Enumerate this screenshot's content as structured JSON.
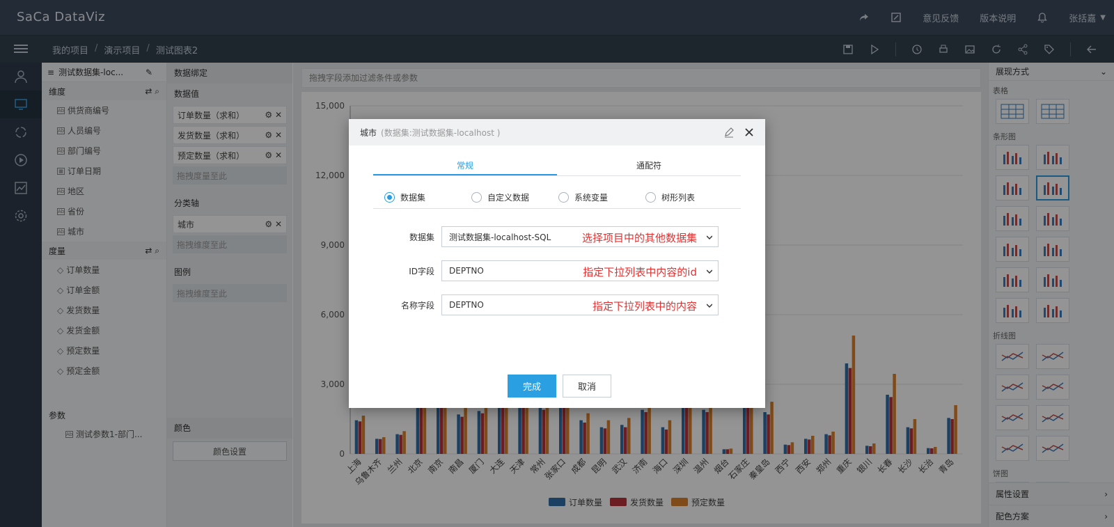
{
  "app": {
    "logo": "SaCa DataViz"
  },
  "header": {
    "feedback": "意见反馈",
    "version": "版本说明",
    "user": "张括嘉"
  },
  "breadcrumb": [
    "我的项目",
    "演示项目",
    "测试图表2"
  ],
  "dataset_panel": {
    "title": "测试数据集-loc...",
    "dimension_label": "维度",
    "dimensions": [
      "供货商编号",
      "人员编号",
      "部门编号",
      "订单日期",
      "地区",
      "省份",
      "城市"
    ],
    "measure_label": "度量",
    "measures": [
      "订单数量",
      "订单金额",
      "发货数量",
      "发货金额",
      "预定数量",
      "预定金额"
    ],
    "param_label": "参数",
    "params": [
      "测试参数1-部门..."
    ]
  },
  "binding_panel": {
    "title": "数据绑定",
    "values_label": "数据值",
    "values": [
      "订单数量（求和）",
      "发货数量（求和）",
      "预定数量（求和）"
    ],
    "values_drop": "拖拽度量至此",
    "axis_label": "分类轴",
    "axis": [
      "城市"
    ],
    "axis_drop": "拖拽维度至此",
    "legend_label": "图例",
    "legend_drop": "拖拽维度至此",
    "color_label": "颜色",
    "color_btn": "颜色设置"
  },
  "filter_hint": "拖拽字段添加过滤条件或参数",
  "chart_data": {
    "type": "bar",
    "categories": [
      "上海",
      "乌鲁木齐",
      "兰州",
      "北京",
      "南京",
      "南昌",
      "厦门",
      "大连",
      "天津",
      "常州",
      "张家口",
      "成都",
      "昆明",
      "武汉",
      "济南",
      "海口",
      "深圳",
      "温州",
      "烟台",
      "石家庄",
      "秦皇岛",
      "西宁",
      "西安",
      "郑州",
      "重庆",
      "银川",
      "长春",
      "长沙",
      "长治",
      "青岛"
    ],
    "yticks": [
      "0",
      "3,000",
      "6,000",
      "9,000",
      "12,000",
      "15,000"
    ],
    "ylim": [
      0,
      15000
    ],
    "series": [
      {
        "name": "订单数量",
        "color": "#2f6fa8",
        "values": [
          1450,
          650,
          850,
          3200,
          3500,
          1700,
          1850,
          3300,
          3400,
          2000,
          3100,
          1450,
          1150,
          1250,
          1900,
          1150,
          3500,
          1900,
          200,
          3700,
          1800,
          400,
          650,
          850,
          3900,
          350,
          2550,
          1150,
          250,
          1550
        ]
      },
      {
        "name": "发货数量",
        "color": "#b8323a",
        "values": [
          1400,
          640,
          820,
          3100,
          3400,
          1600,
          1750,
          3200,
          3300,
          1900,
          3000,
          1350,
          1100,
          1150,
          1800,
          1050,
          3400,
          1800,
          200,
          3600,
          1700,
          380,
          620,
          800,
          3700,
          330,
          2450,
          1100,
          240,
          1500
        ]
      },
      {
        "name": "预定数量",
        "color": "#d9822b",
        "values": [
          1650,
          720,
          980,
          3600,
          3900,
          2050,
          2300,
          3700,
          3800,
          2350,
          3500,
          1750,
          1450,
          1550,
          2250,
          1450,
          3900,
          2300,
          230,
          4100,
          2250,
          500,
          780,
          960,
          5100,
          450,
          3450,
          1500,
          300,
          2100
        ]
      }
    ],
    "legend": [
      "订单数量",
      "发货数量",
      "预定数量"
    ]
  },
  "right_panel": {
    "title": "展现方式",
    "sections": [
      "表格",
      "条形图",
      "折线图",
      "饼图"
    ],
    "property": "属性设置",
    "palette": "配色方案"
  },
  "modal": {
    "title": "城市",
    "subtitle": "(数据集:测试数据集-localhost )",
    "tabs": [
      "常规",
      "通配符"
    ],
    "radios": [
      "数据集",
      "自定义数据",
      "系统变量",
      "树形列表"
    ],
    "fields": [
      {
        "label": "数据集",
        "value": "测试数据集-localhost-SQL",
        "note": "选择项目中的其他数据集"
      },
      {
        "label": "ID字段",
        "value": "DEPTNO",
        "note": "指定下拉列表中内容的id"
      },
      {
        "label": "名称字段",
        "value": "DEPTNO",
        "note": "指定下拉列表中的内容"
      }
    ],
    "ok": "完成",
    "cancel": "取消"
  }
}
